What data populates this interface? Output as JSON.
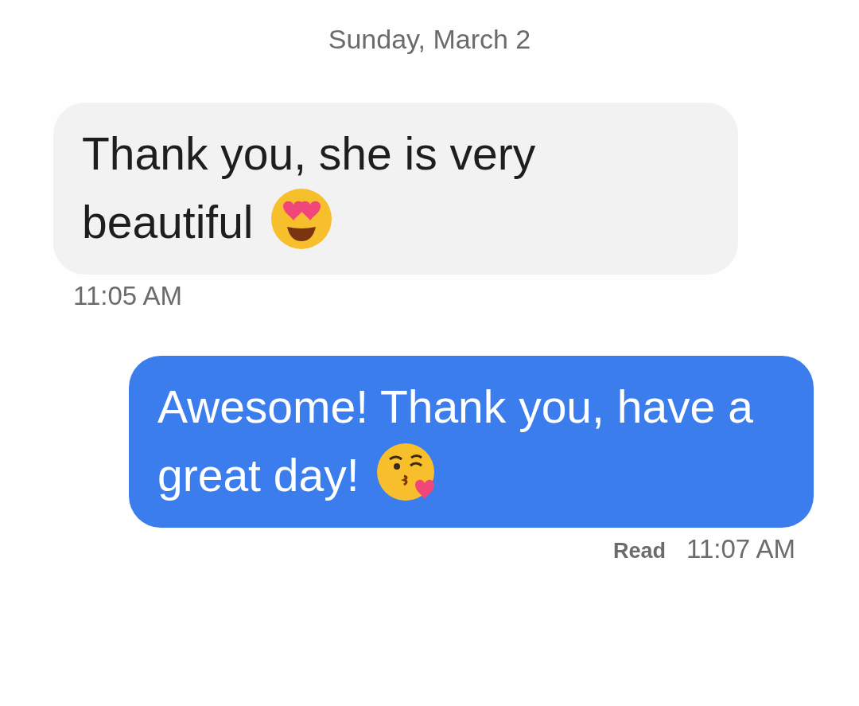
{
  "date_header": "Sunday, March 2",
  "messages": [
    {
      "kind": "incoming",
      "text": "Thank you, she is very beautiful",
      "time": "11:05 AM"
    },
    {
      "kind": "outgoing",
      "text": "Awesome! Thank you, have a great day!",
      "status": "Read",
      "time": "11:07 AM"
    }
  ]
}
